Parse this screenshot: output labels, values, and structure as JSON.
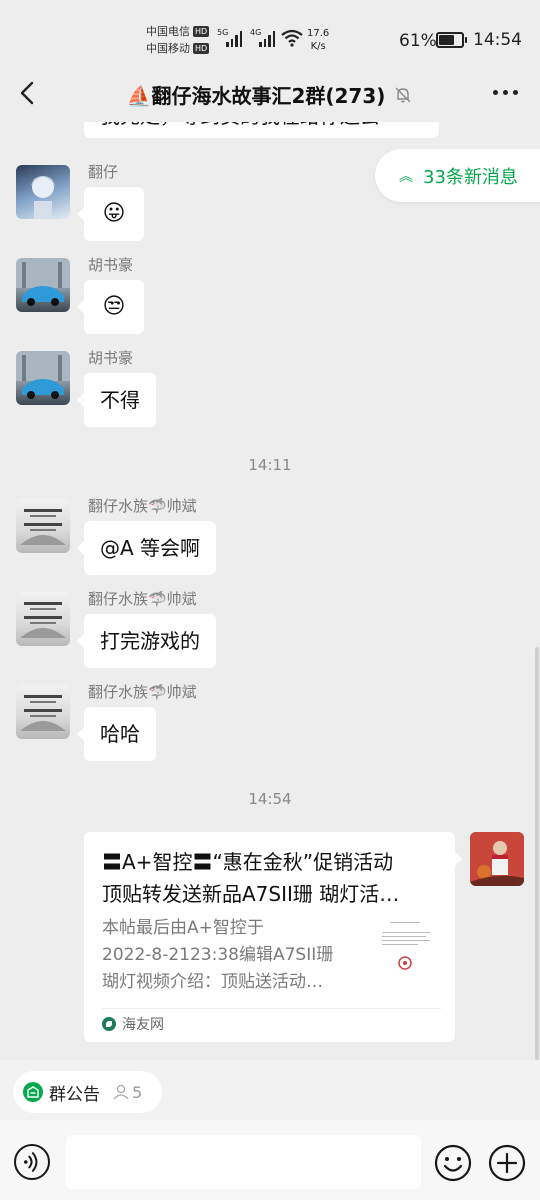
{
  "status_bar": {
    "carrier1": "中国电信",
    "carrier2": "中国移动",
    "hd_label": "HD",
    "sig1_tag": "5G",
    "sig2_tag": "4G",
    "net_speed_value": "17.6",
    "net_speed_unit": "K/s",
    "battery_percent": "61%",
    "battery_level": 0.61,
    "time": "14:54",
    "icons": [
      "signal-icon",
      "wifi-icon",
      "battery-icon"
    ]
  },
  "header": {
    "title": "⛵翻仔海水故事汇2群(273)",
    "icons": [
      "back-arrow-icon",
      "mute-bell-icon",
      "more-dots-icon"
    ]
  },
  "chat": {
    "partial_message": "我先走，等到货的我在给你送去",
    "new_messages_label": "33条新消息",
    "accent_color": "#07a84e",
    "messages": [
      {
        "sender": "翻仔",
        "text": "😛",
        "emoji": true
      },
      {
        "sender": "胡书豪",
        "text": "😒",
        "emoji": true
      },
      {
        "sender": "胡书豪",
        "text": "不得",
        "emoji": false
      },
      {
        "timestamp": "14:11"
      },
      {
        "sender": "翻仔水族🦈帅斌",
        "text": "@A  等会啊",
        "emoji": false
      },
      {
        "sender": "翻仔水族🦈帅斌",
        "text": "打完游戏的",
        "emoji": false
      },
      {
        "sender": "翻仔水族🦈帅斌",
        "text": "哈哈",
        "emoji": false
      },
      {
        "timestamp": "14:54"
      }
    ],
    "link_card": {
      "title_line1": "〓A+智控〓“惠在金秋”促销活动",
      "title_line2": "顶贴转发送新品A7SII珊 瑚灯活…",
      "desc_line1": "本帖最后由A+智控于",
      "desc_line2": "2022-8-2123:38编辑A7SII珊",
      "desc_line3": "瑚灯视频介绍：顶贴送活动…",
      "source": "海友网"
    }
  },
  "notice_bar": {
    "label": "群公告",
    "count": "5"
  },
  "input_bar": {
    "placeholder": "",
    "icons": [
      "voice-icon",
      "emoji-icon",
      "plus-icon"
    ]
  }
}
